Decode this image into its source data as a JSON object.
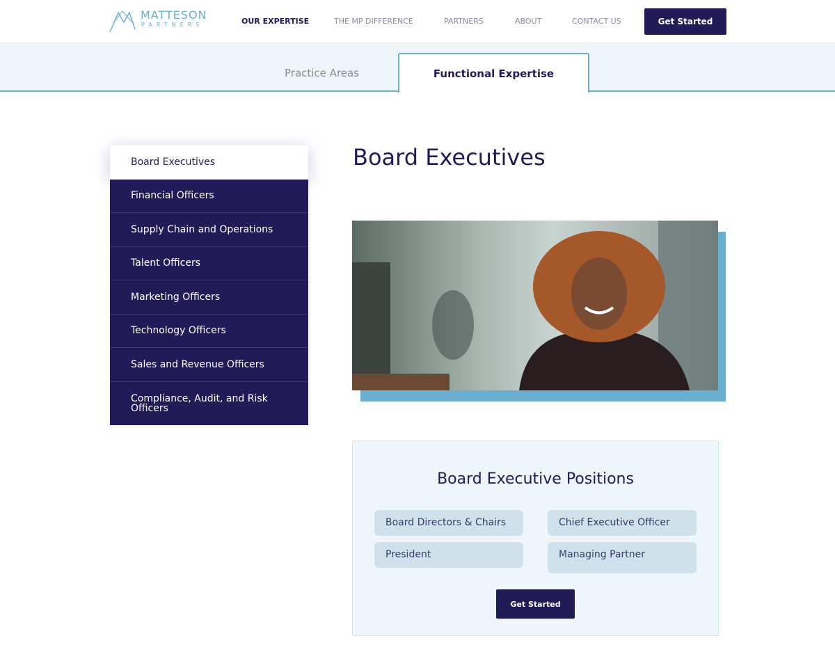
{
  "brand": {
    "name_line1": "MATTESON",
    "name_line2": "PARTNERS",
    "color": "#6aaed0"
  },
  "nav": {
    "items": [
      "OUR EXPERTISE",
      "THE MP DIFFERENCE",
      "PARTNERS",
      "ABOUT",
      "CONTACT US"
    ],
    "active": "OUR EXPERTISE",
    "cta": "Get Started"
  },
  "tabs": {
    "items": [
      "Practice Areas",
      "Functional Expertise"
    ],
    "active": "Functional Expertise"
  },
  "sidebar": {
    "items": [
      "Board Executives",
      "Financial Officers",
      "Supply Chain and Operations",
      "Talent Officers",
      "Marketing Officers",
      "Technology Officers",
      "Sales and Revenue Officers",
      "Compliance, Audit, and Risk Officers"
    ],
    "selected": "Board Executives"
  },
  "main": {
    "title": "Board Executives",
    "positions": {
      "heading": "Board Executive Positions",
      "items": [
        "Board Directors & Chairs",
        "Chief Executive Officer",
        "President",
        "Managing Partner"
      ],
      "cta": "Get Started"
    }
  },
  "colors": {
    "primary": "#211c58",
    "accent": "#6aaed0",
    "panel": "#eef6f9",
    "pill": "#cfe2ec"
  }
}
